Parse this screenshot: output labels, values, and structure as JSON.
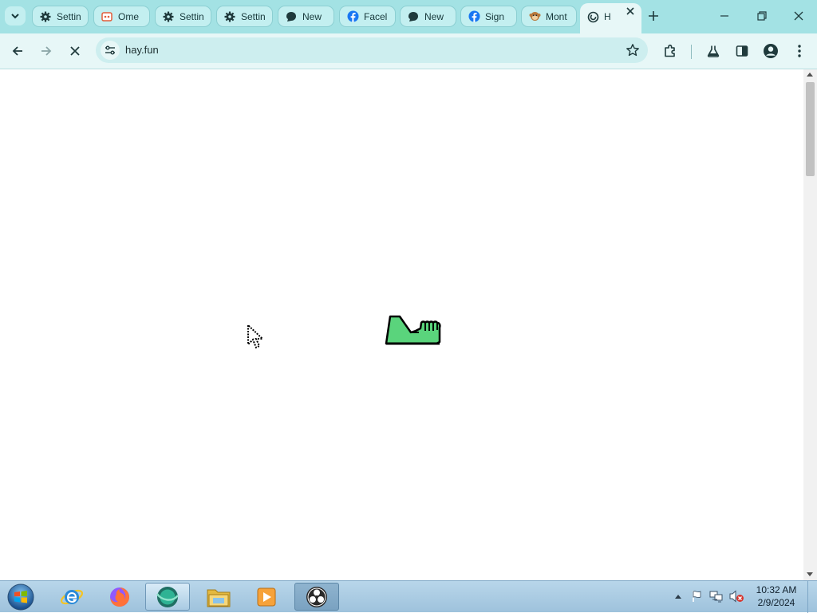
{
  "browser": {
    "tabs": [
      {
        "title": "Settin",
        "icon": "gear-icon"
      },
      {
        "title": "Ome",
        "icon": "omegle-icon"
      },
      {
        "title": "Settin",
        "icon": "gear-icon"
      },
      {
        "title": "Settin",
        "icon": "gear-icon"
      },
      {
        "title": "New",
        "icon": "chat-bubble-icon"
      },
      {
        "title": "Facel",
        "icon": "facebook-icon"
      },
      {
        "title": "New",
        "icon": "chat-bubble-icon"
      },
      {
        "title": "Sign",
        "icon": "facebook-icon"
      },
      {
        "title": "Mont",
        "icon": "monkey-icon"
      },
      {
        "title": "H",
        "icon": "loading-spinner-icon",
        "active": true
      }
    ],
    "url": "hay.fun",
    "loading": true
  },
  "taskbar": {
    "apps": [
      {
        "name": "internet-explorer",
        "icon": "internet-explorer-icon"
      },
      {
        "name": "firefox",
        "icon": "firefox-icon"
      },
      {
        "name": "browser-active",
        "icon": "browser-icon",
        "active": true
      },
      {
        "name": "file-explorer",
        "icon": "folder-icon"
      },
      {
        "name": "media-player",
        "icon": "media-player-icon"
      },
      {
        "name": "obs",
        "icon": "obs-icon",
        "dark": true
      }
    ],
    "clock": {
      "time": "10:32 AM",
      "date": "2/9/2024"
    }
  },
  "colors": {
    "tabstrip": "#a3e2e4",
    "toolbar": "#e7f7f7",
    "sprite_green": "#5ad47c"
  }
}
